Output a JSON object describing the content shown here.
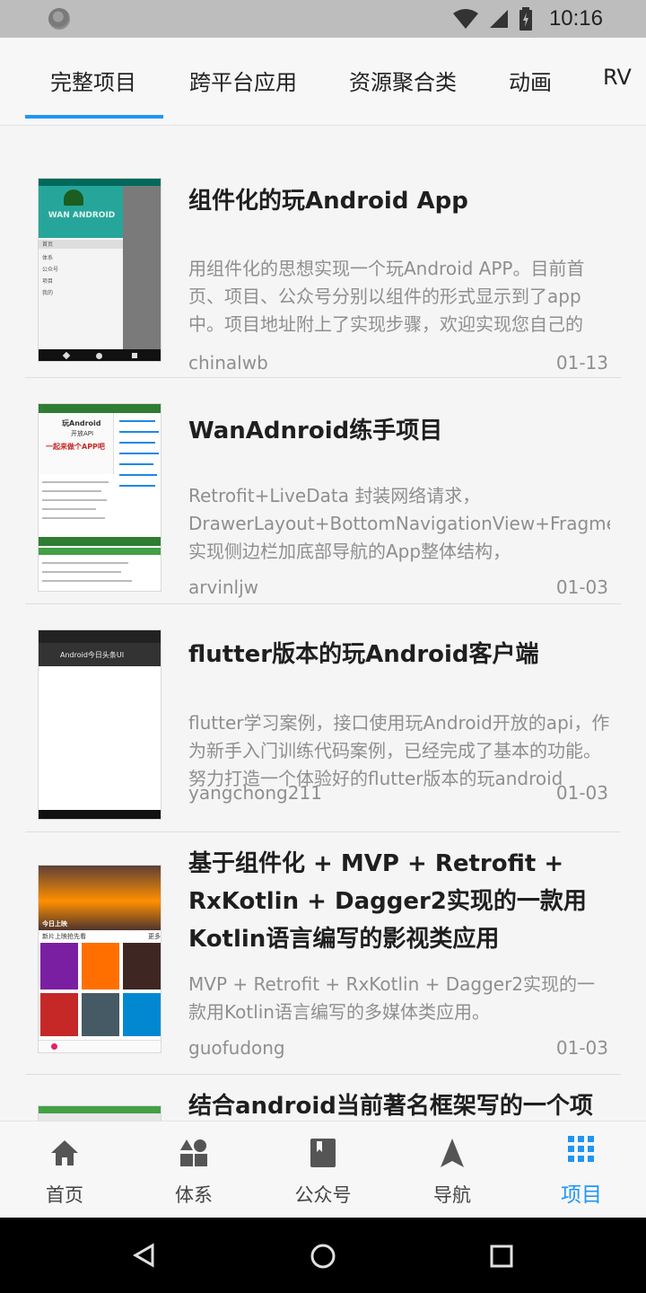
{
  "status_bar": {
    "time": "10:16"
  },
  "tabs": [
    {
      "label": "完整项目",
      "selected": true
    },
    {
      "label": "跨平台应用",
      "selected": false
    },
    {
      "label": "资源聚合类",
      "selected": false
    },
    {
      "label": "动画",
      "selected": false
    },
    {
      "label": "RV",
      "selected": false
    }
  ],
  "projects": [
    {
      "title": "组件化的玩Android App",
      "desc": "用组件化的思想实现一个玩Android APP。目前首页、项目、公众号分别以组件的形式显示到了app中。项目地址附上了实现步骤，欢迎实现您自己的",
      "author": "chinalwb",
      "date": "01-13",
      "thumb_text": {
        "header": "WAN ANDROID",
        "menu": [
          "首页",
          "体系",
          "公众号",
          "项目",
          "我的"
        ]
      }
    },
    {
      "title": "WanAdnroid练手项目",
      "desc": "Retrofit+LiveData 封装网络请求，DrawerLayout+BottomNavigationView+Fragment实现侧边栏加底部导航的App整体结构，",
      "author": "arvinljw",
      "date": "01-03",
      "thumb_text": {
        "line1": "玩Android",
        "line2": "开放API",
        "line3": "一起来做个APP吧"
      }
    },
    {
      "title": "flutter版本的玩Android客户端",
      "desc": "flutter学习案例，接口使用玩Android开放的api，作为新手入门训练代码案例，已经完成了基本的功能。努力打造一个体验好的flutter版本的玩android",
      "author": "yangchong211",
      "date": "01-03",
      "thumb_text": {
        "header": "Android今日头条UI"
      }
    },
    {
      "title": "基于组件化 + MVP + Retrofit + RxKotlin + Dagger2实现的一款用Kotlin语言编写的影视类应用",
      "desc": " MVP + Retrofit + RxKotlin + Dagger2实现的一款用Kotlin语言编写的多媒体类应用。",
      "author": "guofudong",
      "date": "01-03",
      "thumb_text": {
        "banner": "今日上映",
        "row_label": "新片上映抢先看",
        "more": "更多"
      }
    },
    {
      "title": "结合android当前著名框架写的一个项",
      "desc": "",
      "author": "",
      "date": ""
    }
  ],
  "bottom_nav": [
    {
      "label": "首页",
      "icon": "home-icon",
      "active": false
    },
    {
      "label": "体系",
      "icon": "category-icon",
      "active": false
    },
    {
      "label": "公众号",
      "icon": "book-icon",
      "active": false
    },
    {
      "label": "导航",
      "icon": "navigation-icon",
      "active": false
    },
    {
      "label": "项目",
      "icon": "grid-icon",
      "active": true
    }
  ],
  "colors": {
    "accent": "#2196f3",
    "text_primary": "#1f1f1f",
    "text_secondary": "#8f8f8f",
    "nav_inactive": "#555555"
  }
}
